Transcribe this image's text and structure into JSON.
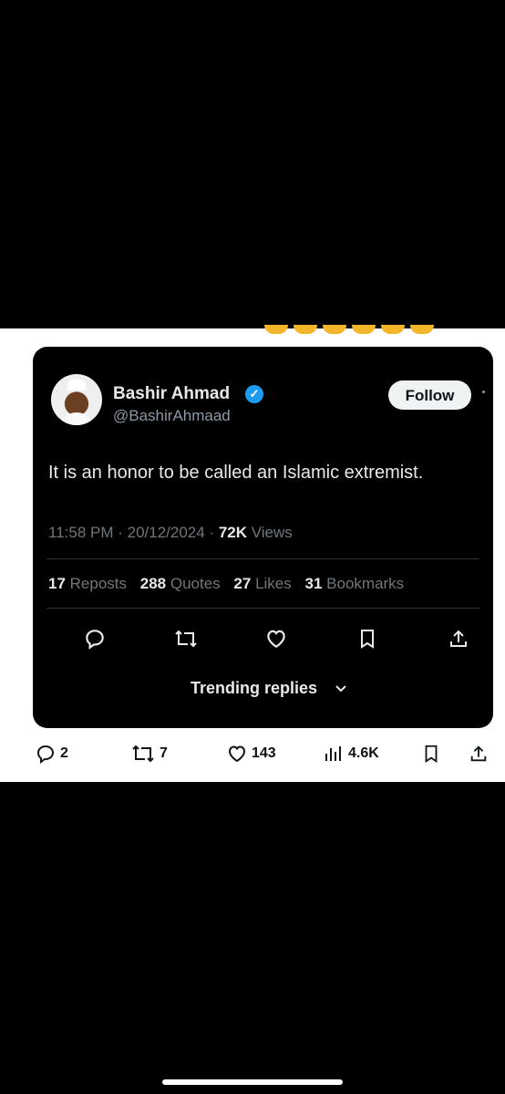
{
  "tweet": {
    "author_name": "Bashir Ahmad",
    "author_handle": "@BashirAhmaad",
    "follow_label": "Follow",
    "text": "It is an honor to be called an Islamic extremist.",
    "time": "11:58 PM",
    "date": "20/12/2024",
    "views_count": "72K",
    "views_label": "Views",
    "reposts_count": "17",
    "reposts_label": "Reposts",
    "quotes_count": "288",
    "quotes_label": "Quotes",
    "likes_count": "27",
    "likes_label": "Likes",
    "bookmarks_count": "31",
    "bookmarks_label": "Bookmarks",
    "trending_label": "Trending replies"
  },
  "post_actions": {
    "replies": "2",
    "reposts": "7",
    "likes": "143",
    "views": "4.6K"
  },
  "colors": {
    "background": "#000000",
    "band": "#ffffff",
    "verified": "#1d9bf0",
    "muted": "#71767b"
  }
}
